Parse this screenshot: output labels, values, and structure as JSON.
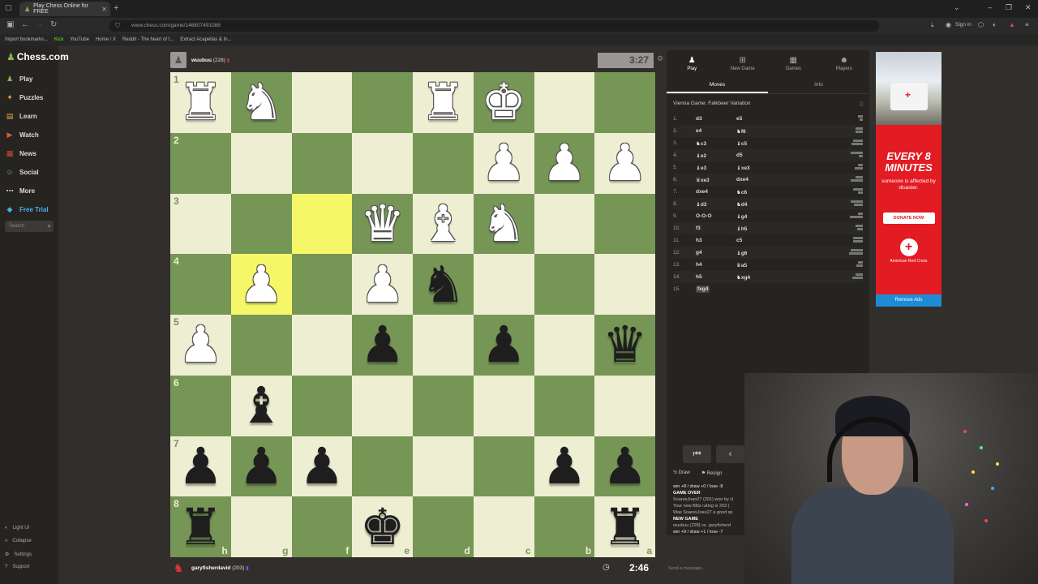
{
  "browser": {
    "tab_title": "Play Chess Online for FREE",
    "url": "www.chess.com/game/146807491088",
    "bookmarks": [
      "Import bookmarks...",
      "Kick",
      "YouTube",
      "Home / X",
      "Reddit - The heart of t...",
      "Extract Acapellas & In..."
    ],
    "sign_in": "Sign in"
  },
  "sidebar": {
    "logo": "Chess.com",
    "items": [
      {
        "label": "Play",
        "icon": "play-icon"
      },
      {
        "label": "Puzzles",
        "icon": "puzzle-icon"
      },
      {
        "label": "Learn",
        "icon": "learn-icon"
      },
      {
        "label": "Watch",
        "icon": "watch-icon"
      },
      {
        "label": "News",
        "icon": "news-icon"
      },
      {
        "label": "Social",
        "icon": "social-icon"
      },
      {
        "label": "More",
        "icon": "more-icon"
      },
      {
        "label": "Free Trial",
        "icon": "diamond-icon"
      }
    ],
    "search_placeholder": "Search",
    "footer": [
      "Light UI",
      "Collapse",
      "Settings",
      "Support"
    ]
  },
  "top_player": {
    "name": "wuubuu",
    "rating": "(228)",
    "clock": "3:27"
  },
  "bottom_player": {
    "name": "garyfisherdavid",
    "rating": "(203)",
    "clock": "2:46"
  },
  "board": {
    "orientation": "black",
    "ranks": [
      "1",
      "2",
      "3",
      "4",
      "5",
      "6",
      "7",
      "8"
    ],
    "files": [
      "h",
      "g",
      "f",
      "e",
      "d",
      "c",
      "b",
      "a"
    ],
    "highlight": [
      "f3",
      "g4"
    ],
    "position": {
      "h1": "wR",
      "g1": "wN",
      "d1": "wR",
      "c1": "wK",
      "c2": "wP",
      "b2": "wP",
      "a2": "wP",
      "e3": "wQ",
      "d3": "wB",
      "c3": "wN",
      "g4": "wP",
      "e4": "wP",
      "d4": "bN",
      "h5": "wP",
      "e5": "bP",
      "c5": "bP",
      "a5": "bQ",
      "g6": "bB",
      "h7": "bP",
      "g7": "bP",
      "f7": "bP",
      "b7": "bP",
      "a7": "bP",
      "h8": "bR",
      "e8": "bK",
      "a8": "bR"
    }
  },
  "panel": {
    "tabs": [
      {
        "label": "Play",
        "icon": "pawn-icon"
      },
      {
        "label": "New Game",
        "icon": "plus-icon"
      },
      {
        "label": "Games",
        "icon": "grid-icon"
      },
      {
        "label": "Players",
        "icon": "players-icon"
      }
    ],
    "subtabs": [
      "Moves",
      "Info"
    ],
    "opening": "Vienna Game: Falkbeer Variation",
    "moves": [
      {
        "n": "1.",
        "w": "d3",
        "b": "e5"
      },
      {
        "n": "2.",
        "w": "e4",
        "b": "♞f6"
      },
      {
        "n": "3.",
        "w": "♞c3",
        "b": "♝c5"
      },
      {
        "n": "4.",
        "w": "♝e2",
        "b": "d5"
      },
      {
        "n": "5.",
        "w": "♝e3",
        "b": "♝xe3"
      },
      {
        "n": "6.",
        "w": "♛xe3",
        "b": "dxe4"
      },
      {
        "n": "7.",
        "w": "dxe4",
        "b": "♞c6"
      },
      {
        "n": "8.",
        "w": "♝d3",
        "b": "♞d4"
      },
      {
        "n": "9.",
        "w": "O-O-O",
        "b": "♝g4"
      },
      {
        "n": "10.",
        "w": "f3",
        "b": "♝h5"
      },
      {
        "n": "11.",
        "w": "h3",
        "b": "c5"
      },
      {
        "n": "12.",
        "w": "g4",
        "b": "♝g6"
      },
      {
        "n": "13.",
        "w": "h4",
        "b": "♛a5"
      },
      {
        "n": "14.",
        "w": "h5",
        "b": "♞xg4"
      },
      {
        "n": "15.",
        "w": "fxg4",
        "b": ""
      }
    ],
    "draw_label": "Draw",
    "resign_label": "Resign",
    "chat": [
      "win +8 / draw +0 / lose -8",
      "GAME OVER",
      "SoaresJoao27 (201) won by cl",
      "Your new Blitz rating is 203 (",
      "Was SoaresJoao27 a good sp",
      "NEW GAME",
      "wuubuu (228) vs. garyfisherd",
      "win +9 / draw +1 / lose -7"
    ],
    "chat_placeholder": "Send a message..."
  },
  "ad": {
    "headline": "EVERY 8 MINUTES",
    "sub": "someone is affected by disaster.",
    "button": "DONATE NOW",
    "org": "American Red Cross",
    "remove": "Remove Ads"
  },
  "colors": {
    "light_square": "#eeeed2",
    "dark_square": "#769656",
    "highlight": "#f6f669",
    "ad_red": "#e31b23"
  }
}
